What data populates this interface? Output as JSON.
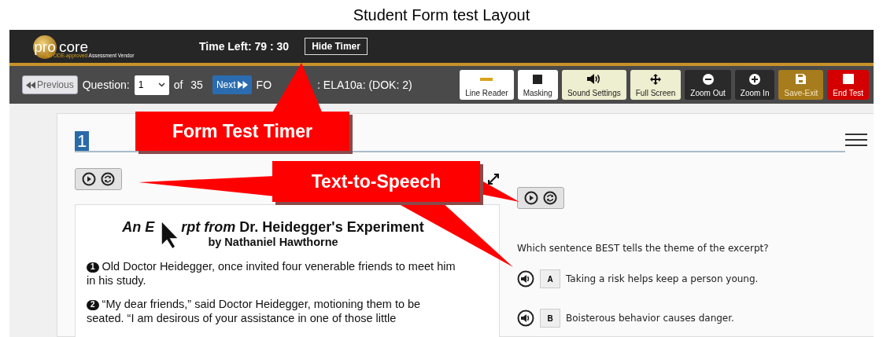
{
  "title": "Student Form test Layout",
  "header": {
    "logo_pro": "pro",
    "logo_core": "core",
    "tagline_lead": "An ODE-approved",
    "tagline_rest": "Assessment Vendor",
    "timer": "Time Left: 79 : 30",
    "hide_button": "Hide Timer"
  },
  "nav": {
    "previous": "Previous",
    "question_label": "Question:",
    "question_value": "1",
    "of": "of",
    "total": "35",
    "next": "Next",
    "form_start": "FO",
    "form_end": ": ELA10a: (DOK: 2)"
  },
  "tools": [
    {
      "label": "Line Reader",
      "kind": "line"
    },
    {
      "label": "Masking",
      "kind": "mask"
    },
    {
      "label": "Sound Settings",
      "kind": "sound"
    },
    {
      "label": "Full Screen",
      "kind": "move"
    },
    {
      "label": "Zoom Out",
      "kind": "zoomout"
    },
    {
      "label": "Zoom In",
      "kind": "zoomin"
    },
    {
      "label": "Save-Exit",
      "kind": "save"
    },
    {
      "label": "End Test",
      "kind": "end"
    }
  ],
  "item_number": "1",
  "passage": {
    "title_start": "An E",
    "title_italic_end": "rpt from",
    "title_rest": "Dr. Heidegger's Experiment",
    "author": "by Nathaniel Hawthorne",
    "paragraphs": [
      {
        "number": "1",
        "text": "Old Doctor Heidegger, once invited four venerable friends to meet him in his study."
      },
      {
        "number": "2",
        "text": "“My dear friends,” said Doctor Heidegger, motioning them to be seated. “I am desirous of your assistance in one of those little"
      }
    ]
  },
  "question": {
    "stem": "Which sentence BEST tells the theme of the excerpt?",
    "choices": [
      {
        "letter": "A",
        "text": "Taking a risk helps keep a person young."
      },
      {
        "letter": "B",
        "text": "Boisterous behavior causes danger."
      }
    ]
  },
  "callouts": [
    {
      "label": "Form Test Timer"
    },
    {
      "label": "Text-to-Speech"
    }
  ]
}
